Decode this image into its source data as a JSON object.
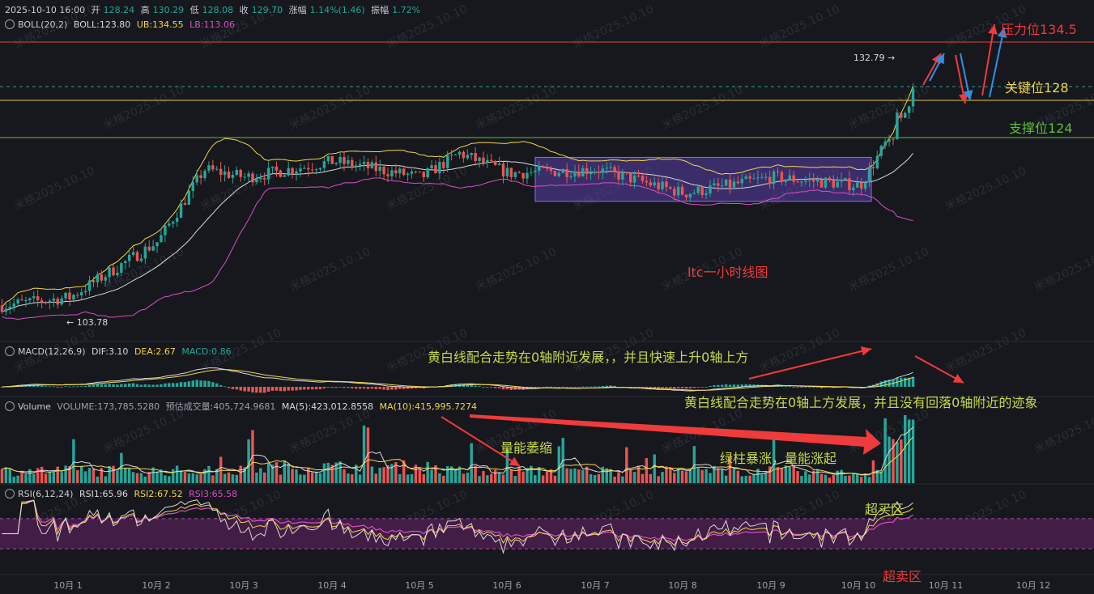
{
  "header": {
    "datetime": "2025-10-10 16:00",
    "open_label": "开",
    "open": "128.24",
    "high_label": "高",
    "high": "130.29",
    "low_label": "低",
    "low": "128.08",
    "close_label": "收",
    "close": "129.70",
    "change_label": "涨幅",
    "change": "1.14%(1.46)",
    "amp_label": "振幅",
    "amp": "1.72%"
  },
  "boll": {
    "name": "BOLL(20,2)",
    "mid": "BOLL:123.80",
    "ub": "UB:134.55",
    "lb": "LB:113.06"
  },
  "macd": {
    "name": "MACD(12,26,9)",
    "dif": "DIF:3.10",
    "dea": "DEA:2.67",
    "macd": "MACD:0.86"
  },
  "volume": {
    "name": "Volume",
    "vol": "VOLUME:173,785.5280",
    "est": "预估成交量:405,724.9681",
    "ma5": "MA(5):423,012.8558",
    "ma10": "MA(10):415,995.7274"
  },
  "rsi": {
    "name": "RSI(6,12,24)",
    "r1": "RSI1:65.96",
    "r2": "RSI2:67.52",
    "r3": "RSI3:65.58"
  },
  "watermark": "米格2025.10.10",
  "annotations": {
    "resistance": "压力位134.5",
    "key": "关键位128",
    "support": "支撑位124",
    "chart_title": "ltc一小时线图",
    "macd_note1": "黄白线配合走势在0轴附近发展，，并且快速上升0轴上方",
    "macd_note2": "黄白线配合走势在0轴上方发展，并且没有回落0轴附近的迹象",
    "vol_shrink": "量能萎缩",
    "vol_surge": "绿柱暴涨，量能涨起",
    "overbought": "超买区",
    "oversold": "超卖区",
    "high_mark": "132.79",
    "low_mark": "103.78"
  },
  "colors": {
    "bg": "#16181d",
    "up": "#26a69a",
    "down": "#ef5350",
    "yellow": "#f3d54e",
    "white": "#d9d9d9",
    "magenta": "#d84fc8",
    "red_line": "#e0443e",
    "green_line": "#5fbf3a",
    "rect": "#5b3fa8"
  },
  "chart_data": {
    "type": "candlestick",
    "symbol": "ltc",
    "interval": "1h",
    "x_ticks": [
      "10月 1",
      "10月 2",
      "10月 3",
      "10月 4",
      "10月 5",
      "10月 6",
      "10月 7",
      "10月 8",
      "10月 9",
      "10月 10",
      "10月 11",
      "10月 12"
    ],
    "levels": {
      "resistance": 134.5,
      "key": 128,
      "support": 124
    },
    "extremes": {
      "high": 132.79,
      "low": 103.78
    },
    "consolidation_box": {
      "from": "10月 6",
      "to": "10月 10",
      "low": 116.5,
      "high": 122.0
    },
    "price_path_keypoints": [
      {
        "x": "10月 1",
        "price": 104.5
      },
      {
        "x": "10月 2",
        "price": 111.5
      },
      {
        "x": "10月 2",
        "price": 120.5
      },
      {
        "x": "10月 3",
        "price": 119.5
      },
      {
        "x": "10月 4",
        "price": 121.5
      },
      {
        "x": "10月 5",
        "price": 119.5
      },
      {
        "x": "10月 5",
        "price": 122.5
      },
      {
        "x": "10月 6",
        "price": 120.0
      },
      {
        "x": "10月 7",
        "price": 120.5
      },
      {
        "x": "10月 8",
        "price": 117.5
      },
      {
        "x": "10月 9",
        "price": 119.5
      },
      {
        "x": "10月 10",
        "price": 118.5
      },
      {
        "x": "10月 10",
        "price": 129.7
      }
    ],
    "rsi_bands": [
      30,
      70
    ]
  }
}
